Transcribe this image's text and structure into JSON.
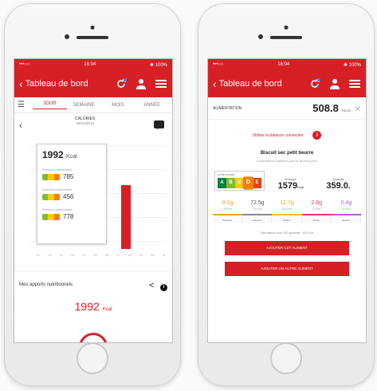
{
  "colors": {
    "accent": "#d71f26",
    "nutri_a": "#038141",
    "nutri_b": "#85bb2f",
    "nutri_c": "#fecb02",
    "nutri_d": "#ee8100",
    "nutri_e": "#e63e11"
  },
  "status": {
    "carrier": "•••○○",
    "time": "16:04",
    "battery": "✱ 100%"
  },
  "header": {
    "title": "Tableau de bord",
    "back_icon": "chevron-left-icon"
  },
  "left": {
    "tabs": [
      "JOUR",
      "SEMAINE",
      "MOIS",
      "ANNÉE"
    ],
    "calories_label": "CALORIES",
    "date": "29/01/2018",
    "popup": {
      "total": "1992",
      "unit": "Kcal",
      "rows": [
        {
          "caption": "Formules nutritionnelles",
          "value": "785",
          "unit": "Kcal"
        },
        {
          "caption": "Formules nutritionnelles",
          "value": "456",
          "unit": "Kcal"
        },
        {
          "caption": "Formules nutritionnelles",
          "value": "778",
          "unit": "Kcal"
        }
      ]
    },
    "axis": [
      "20",
      "21",
      "22",
      "23",
      "24",
      "25",
      "26",
      "27",
      "28",
      "29",
      "30",
      "31"
    ],
    "apports_label": "Mes apports nutritionnels",
    "kcal_value": "1992",
    "kcal_unit": "Kcal"
  },
  "right": {
    "section_label": "ALIMENTATION",
    "total": "508.8",
    "total_unit": "KCAL",
    "scale_label": "Utiliser la balance connectée",
    "product_name": "Biscuit sec petit beurre",
    "product_sub": "Informations nutritives pour le produit pesé",
    "nutriscore_label": "NUTRI-SCORE",
    "nutriscore_letters": [
      "A",
      "B",
      "C",
      "D",
      "E"
    ],
    "nutriscore_selected": "D",
    "energy_label": "Énergie",
    "energy_value": "1579",
    "energy_unit": "Kcal",
    "qty_label": "Quantité",
    "qty_value": "359.0",
    "qty_unit": "g",
    "macros": [
      {
        "g": "8.2g",
        "p": "(8.0%)",
        "label": "Protéines",
        "color": "#f0a030"
      },
      {
        "g": "72.5g",
        "p": "(75.1%)",
        "label": "Glucides",
        "color": "#8a8a8a"
      },
      {
        "g": "12.7g",
        "p": "(13.2%)",
        "label": "Lipides",
        "color": "#f4c93a"
      },
      {
        "g": "2.8g",
        "p": "(2.9%)",
        "label": "Fibres",
        "color": "#e0357a"
      },
      {
        "g": "0.4g",
        "p": "(0.4%)",
        "label": "Sodium",
        "color": "#b05ad6"
      }
    ],
    "equivalence": "Équivalence pour 100 grammes : 439 Kcal",
    "btn_add": "AJOUTER CET ALIMENT",
    "btn_add_other": "AJOUTER UN AUTRE ALIMENT"
  }
}
